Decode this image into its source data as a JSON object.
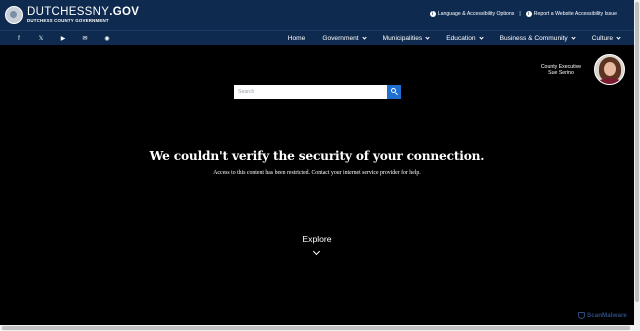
{
  "header": {
    "logo_main_light": "DUTCHESSNY",
    "logo_main_bold": ".GOV",
    "logo_sub": "DUTCHESS COUNTY GOVERNMENT",
    "language_link": "Language & Accessibility Options",
    "separator": "|",
    "report_link": "Report a Website Accessibility Issue"
  },
  "social": [
    {
      "icon": "facebook-icon",
      "glyph": "f"
    },
    {
      "icon": "x-twitter-icon",
      "glyph": "𝕏"
    },
    {
      "icon": "youtube-icon",
      "glyph": "▶"
    },
    {
      "icon": "email-icon",
      "glyph": "✉"
    },
    {
      "icon": "rss-icon",
      "glyph": "◉"
    }
  ],
  "nav": {
    "items": [
      {
        "label": "Home",
        "dropdown": false
      },
      {
        "label": "Government",
        "dropdown": true
      },
      {
        "label": "Municipalities",
        "dropdown": true
      },
      {
        "label": "Education",
        "dropdown": true
      },
      {
        "label": "Business & Community",
        "dropdown": true
      },
      {
        "label": "Culture",
        "dropdown": true
      }
    ]
  },
  "executive": {
    "title": "County Executive",
    "name": "Sue Serino"
  },
  "search": {
    "placeholder": "Search"
  },
  "message": {
    "headline": "We couldn't verify the security of your connection.",
    "subline": "Access to this content has been restricted. Contact your internet service provider for help."
  },
  "explore": {
    "label": "Explore"
  },
  "watermark": {
    "text": "ScanMalware"
  },
  "colors": {
    "header_bg": "#0e2a4f",
    "page_bg": "#000000",
    "search_button": "#1f6fd1"
  }
}
